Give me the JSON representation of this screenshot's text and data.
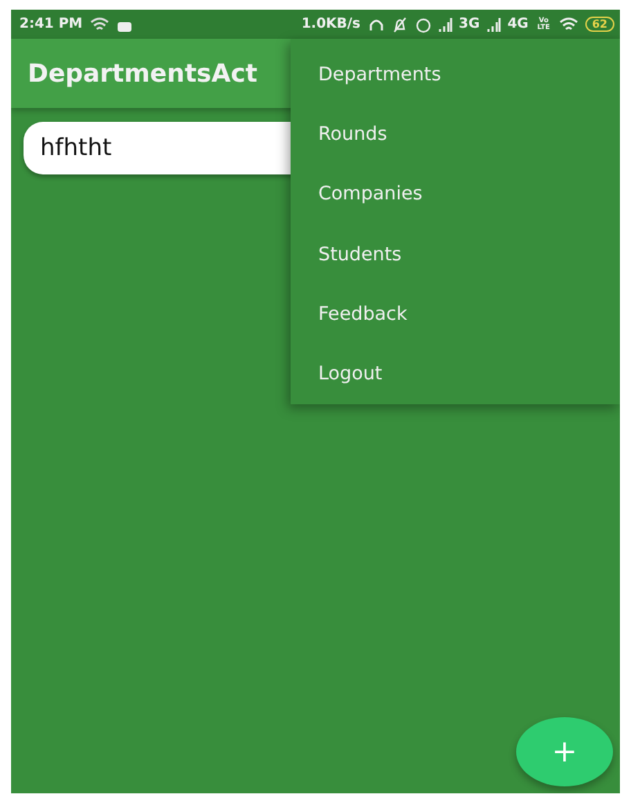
{
  "status_bar": {
    "time": "2:41 PM",
    "speed": "1.0KB/s",
    "network_1": "3G",
    "network_2": "4G",
    "volte": "Vo LTE",
    "battery": "62"
  },
  "app_bar": {
    "title": "DepartmentsAct"
  },
  "list": [
    {
      "text": "hfhtht"
    }
  ],
  "menu": [
    {
      "label": "Departments"
    },
    {
      "label": "Rounds"
    },
    {
      "label": "Companies"
    },
    {
      "label": "Students"
    },
    {
      "label": "Feedback"
    },
    {
      "label": "Logout"
    }
  ],
  "fab": {
    "label": "+"
  }
}
